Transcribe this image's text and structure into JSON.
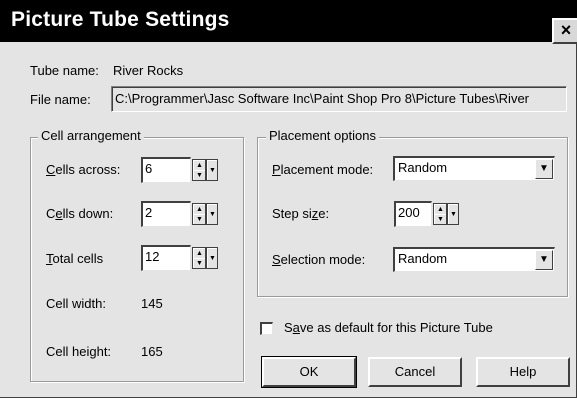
{
  "window": {
    "title": "Picture Tube Settings",
    "close_glyph": "×"
  },
  "tube": {
    "name_label": "Tube name:",
    "name_value": "River Rocks",
    "file_label": "File name:",
    "file_value": "C:\\Programmer\\Jasc Software Inc\\Paint Shop Pro 8\\Picture Tubes\\River"
  },
  "cell_arrangement": {
    "legend": "Cell arrangement",
    "cells_across": {
      "mnemonic": "C",
      "rest": "ells across:",
      "value": "6"
    },
    "cells_down": {
      "pre": "C",
      "mnemonic": "e",
      "rest": "lls down:",
      "value": "2"
    },
    "total_cells": {
      "mnemonic": "T",
      "rest": "otal cells",
      "value": "12"
    },
    "cell_width": {
      "label": "Cell width:",
      "value": "145"
    },
    "cell_height": {
      "label": "Cell height:",
      "value": "165"
    }
  },
  "placement_options": {
    "legend": "Placement options",
    "placement_mode": {
      "mnemonic": "P",
      "rest": "lacement mode:",
      "value": "Random"
    },
    "step_size": {
      "pre": "Step si",
      "mnemonic": "z",
      "rest": "e:",
      "value": "200"
    },
    "selection_mode": {
      "mnemonic": "S",
      "rest": "election mode:",
      "value": "Random"
    }
  },
  "save_default": {
    "pre": "S",
    "mnemonic": "a",
    "rest": "ve as default for this Picture Tube",
    "checked": false
  },
  "buttons": {
    "ok": "OK",
    "cancel": "Cancel",
    "help": "Help"
  },
  "icons": {
    "spin_up": "▲",
    "spin_down": "▼",
    "dropdown": "▼"
  }
}
